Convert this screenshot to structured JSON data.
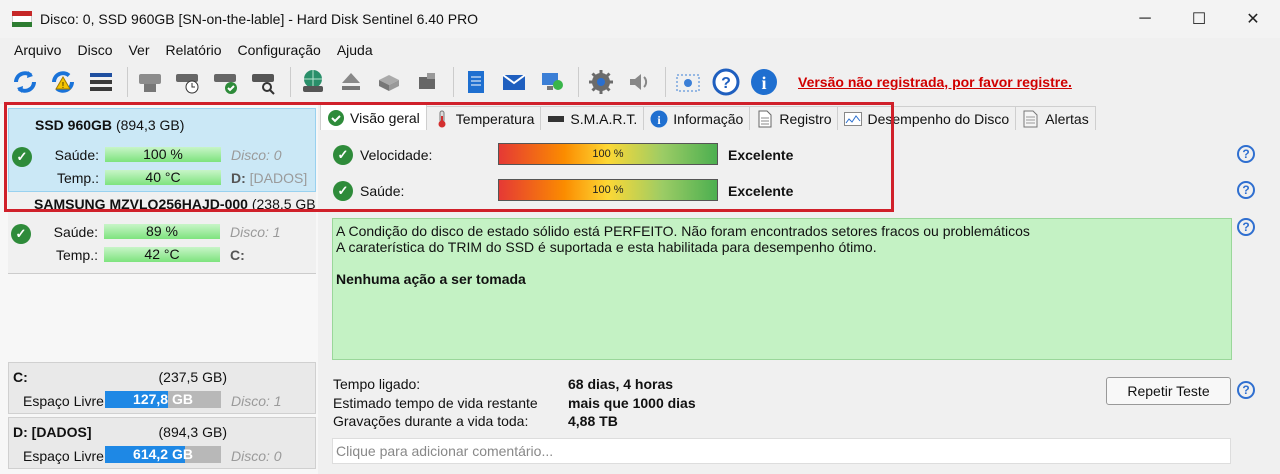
{
  "window": {
    "title": "Disco: 0, SSD 960GB [SN-on-the-lable]  -  Hard Disk Sentinel 6.40 PRO",
    "minimize": "─",
    "maximize": "☐",
    "close": "✕"
  },
  "menu": [
    {
      "label": "Arquivo"
    },
    {
      "label": "Disco"
    },
    {
      "label": "Ver"
    },
    {
      "label": "Relatório"
    },
    {
      "label": "Configuração"
    },
    {
      "label": "Ajuda"
    }
  ],
  "toolbar": {
    "registration_warning": "Versão não registrada, por favor registre."
  },
  "disks": [
    {
      "name": "SSD 960GB",
      "size": "(894,3 GB)",
      "health_label": "Saúde:",
      "health": "100 %",
      "temp_label": "Temp.:",
      "temp": "40 °C",
      "disk_ref": "Disco: 0",
      "partition": "D:",
      "partition_name": "[DADOS]"
    },
    {
      "name": "SAMSUNG MZVLQ256HAJD-000",
      "size": "(238,5 GB",
      "health_label": "Saúde:",
      "health": "89 %",
      "temp_label": "Temp.:",
      "temp": "42 °C",
      "disk_ref": "Disco: 1",
      "partition": "C:"
    }
  ],
  "volumes": [
    {
      "name": "C:",
      "size": "(237,5 GB)",
      "free_label": "Espaço Livre",
      "free": "127,8 GB",
      "free_fraction": 0.54,
      "disk_ref": "Disco: 1"
    },
    {
      "name": "D: [DADOS]",
      "size": "(894,3 GB)",
      "free_label": "Espaço Livre",
      "free": "614,2 GB",
      "free_fraction": 0.69,
      "disk_ref": "Disco: 0"
    }
  ],
  "tabs": [
    {
      "label": "Visão geral",
      "icon": "check-icon",
      "active": true
    },
    {
      "label": "Temperatura",
      "icon": "thermometer-icon"
    },
    {
      "label": "S.M.A.R.T.",
      "icon": "chip-icon"
    },
    {
      "label": "Informação",
      "icon": "info-icon"
    },
    {
      "label": "Registro",
      "icon": "document-icon"
    },
    {
      "label": "Desempenho do Disco",
      "icon": "performance-chart-icon"
    },
    {
      "label": "Alertas",
      "icon": "alerts-icon"
    }
  ],
  "overview": {
    "speed_label": "Velocidade:",
    "speed_value": "100 %",
    "speed_status": "Excelente",
    "health_label": "Saúde:",
    "health_value": "100 %",
    "health_status": "Excelente",
    "message_line1": "A Condição do disco de estado sólido está PERFEITO. Não foram encontrados setores fracos ou problemáticos",
    "message_line2": "A caraterística do TRIM do SSD é suportada e esta habilitada para desempenho ótimo.",
    "action": "Nenhuma ação a ser tomada",
    "power_on_label": "Tempo ligado:",
    "power_on_value": "68 dias, 4 horas",
    "remaining_label": "Estimado tempo de vida restante",
    "remaining_value": "mais que 1000 dias",
    "writes_label": "Gravações durante a vida toda:",
    "writes_value": "4,88 TB",
    "repeat_button": "Repetir Teste",
    "comment_placeholder": "Clique para adicionar  comentário..."
  },
  "colors": {
    "highlight": "#d0202a",
    "warning": "#d00000",
    "status_ok": "#2e8b3a",
    "status_box": "#c4f2c4",
    "selected_disk": "#cbe8f6"
  }
}
